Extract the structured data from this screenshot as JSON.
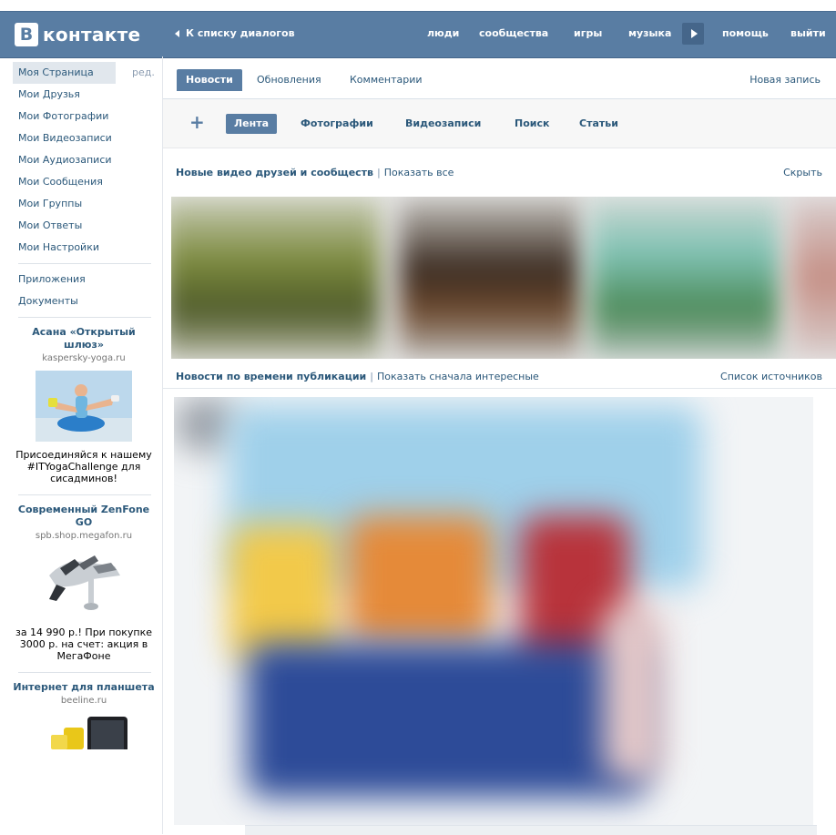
{
  "header": {
    "logo_letter": "В",
    "logo_text": "контакте",
    "back_link": "К списку диалогов",
    "nav": {
      "people": "люди",
      "communities": "сообщества",
      "games": "игры",
      "music": "музыка",
      "help": "помощь",
      "logout": "выйти"
    }
  },
  "sidebar": {
    "edit": "ред.",
    "items": [
      {
        "label": "Моя Страница"
      },
      {
        "label": "Мои Друзья"
      },
      {
        "label": "Мои Фотографии"
      },
      {
        "label": "Мои Видеозаписи"
      },
      {
        "label": "Мои Аудиозаписи"
      },
      {
        "label": "Мои Сообщения"
      },
      {
        "label": "Мои Группы"
      },
      {
        "label": "Мои Ответы"
      },
      {
        "label": "Мои Настройки"
      }
    ],
    "extra": [
      {
        "label": "Приложения"
      },
      {
        "label": "Документы"
      }
    ],
    "ads": [
      {
        "title": "Асана «Открытый шлюз»",
        "domain": "kaspersky-yoga.ru",
        "text": "Присоединяйся к нашему #ITYogaChallenge для сисадминов!"
      },
      {
        "title": "Современный ZenFone GO",
        "domain": "spb.shop.megafon.ru",
        "text": "за 14 990 р.! При покупке 3000 р. на счет: акция в МегаФоне"
      },
      {
        "title": "Интернет для планшета",
        "domain": "beeline.ru",
        "text": ""
      }
    ]
  },
  "main": {
    "tabs": [
      {
        "label": "Новости"
      },
      {
        "label": "Обновления"
      },
      {
        "label": "Комментарии"
      }
    ],
    "new_post": "Новая запись",
    "filters": [
      {
        "label": "Лента"
      },
      {
        "label": "Фотографии"
      },
      {
        "label": "Видеозаписи"
      },
      {
        "label": "Поиск"
      },
      {
        "label": "Статьи"
      }
    ],
    "videos_section": {
      "title": "Новые видео друзей и сообществ",
      "separator": "|",
      "show_all": "Показать все",
      "hide": "Скрыть"
    },
    "news_section": {
      "title": "Новости по времени публикации",
      "separator": "|",
      "show_interesting": "Показать сначала интересные",
      "sources": "Список источников"
    }
  },
  "colors": {
    "header_bg": "#597da3",
    "link": "#2b587a",
    "active_tab": "#597da3"
  }
}
